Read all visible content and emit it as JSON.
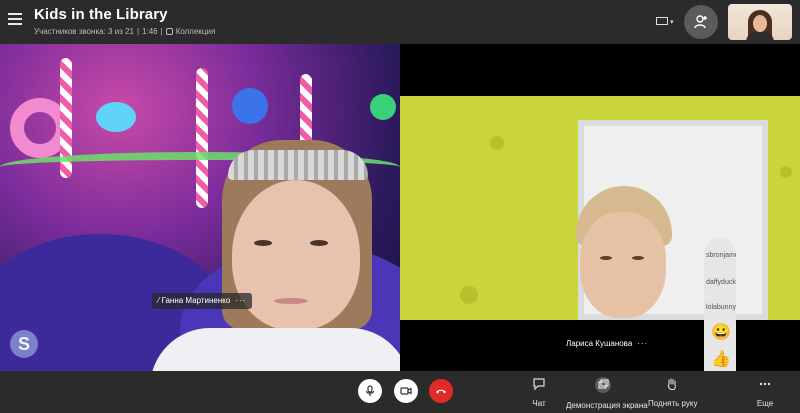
{
  "header": {
    "title": "Kids in the Library",
    "participants_text": "Участников звонка: 3 из 21",
    "duration": "1:46",
    "collection_label": "Коллекция"
  },
  "participants": {
    "left_name": "Ганна Мартиненко",
    "right_name": "Лариса Кушанова",
    "more_glyph": "···"
  },
  "reactions": {
    "users": [
      "sbronjame",
      "daffyduck",
      "lolabunny"
    ],
    "emojis": [
      {
        "icon": "smile-emoji",
        "glyph": "😀"
      },
      {
        "icon": "thumbs-up-emoji",
        "glyph": "👍"
      },
      {
        "icon": "heart-emoji",
        "glyph": "❤"
      }
    ]
  },
  "toolbar": {
    "chat_label": "Чат",
    "share_label": "Демонстрация экрана",
    "raise_hand_label": "Поднять руку",
    "more_label": "Еще"
  },
  "watermark": "S",
  "colors": {
    "end_call": "#e02b2b",
    "header_bg": "#2b2b2b",
    "toolbar_bg": "#2b2b2b"
  }
}
